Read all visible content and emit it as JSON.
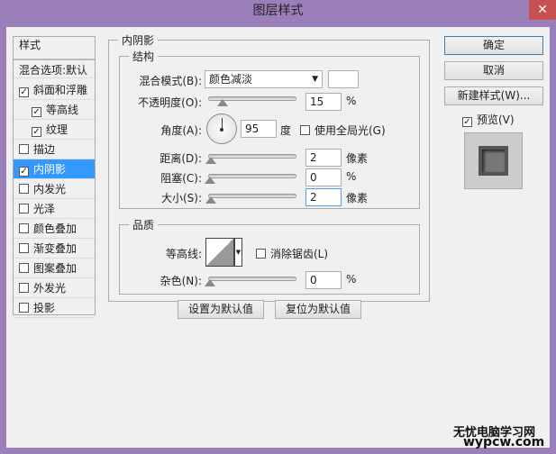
{
  "window": {
    "title": "图层样式",
    "close": "✕"
  },
  "sidebar": {
    "header": "样式",
    "blend": "混合选项:默认",
    "items": [
      {
        "label": "斜面和浮雕",
        "checked": true,
        "indent": false
      },
      {
        "label": "等高线",
        "checked": true,
        "indent": true
      },
      {
        "label": "纹理",
        "checked": true,
        "indent": true
      },
      {
        "label": "描边",
        "checked": false,
        "indent": false
      },
      {
        "label": "内阴影",
        "checked": true,
        "indent": false,
        "selected": true
      },
      {
        "label": "内发光",
        "checked": false,
        "indent": false
      },
      {
        "label": "光泽",
        "checked": false,
        "indent": false
      },
      {
        "label": "颜色叠加",
        "checked": false,
        "indent": false
      },
      {
        "label": "渐变叠加",
        "checked": false,
        "indent": false
      },
      {
        "label": "图案叠加",
        "checked": false,
        "indent": false
      },
      {
        "label": "外发光",
        "checked": false,
        "indent": false
      },
      {
        "label": "投影",
        "checked": false,
        "indent": false
      }
    ]
  },
  "panel": {
    "title": "内阴影",
    "structure": {
      "title": "结构",
      "blend_mode_label": "混合模式(B):",
      "blend_mode": "颜色减淡",
      "blend_color": "#ffffff",
      "opacity_label": "不透明度(O):",
      "opacity": "15",
      "opacity_unit": "%",
      "angle_label": "角度(A):",
      "angle": "95",
      "angle_unit": "度",
      "global_light_label": "使用全局光(G)",
      "global_light": false,
      "distance_label": "距离(D):",
      "distance": "2",
      "distance_unit": "像素",
      "choke_label": "阻塞(C):",
      "choke": "0",
      "choke_unit": "%",
      "size_label": "大小(S):",
      "size": "2",
      "size_unit": "像素"
    },
    "quality": {
      "title": "品质",
      "contour_label": "等高线:",
      "antialias_label": "消除锯齿(L)",
      "antialias": false,
      "noise_label": "杂色(N):",
      "noise": "0",
      "noise_unit": "%"
    },
    "set_default": "设置为默认值",
    "reset_default": "复位为默认值"
  },
  "buttons": {
    "ok": "确定",
    "cancel": "取消",
    "new_style": "新建样式(W)...",
    "preview_label": "预览(V)",
    "preview": true
  },
  "watermark": {
    "line1": "无忧电脑学习网",
    "line2": "wypcw.com"
  }
}
